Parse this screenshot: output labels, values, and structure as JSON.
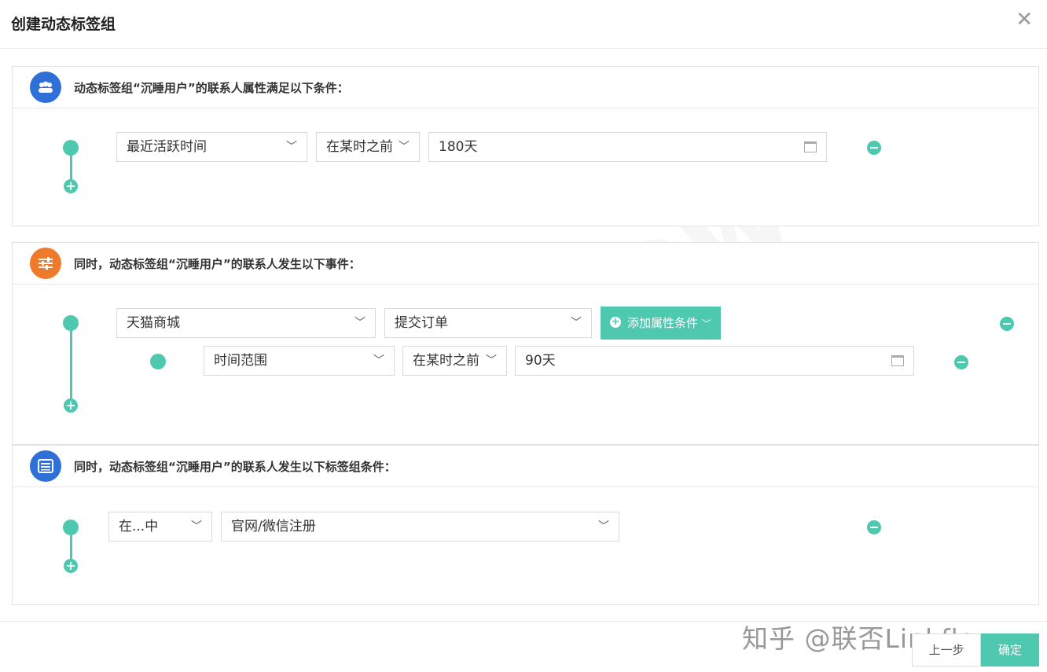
{
  "dialog": {
    "title": "创建动态标签组"
  },
  "watermark": "Linkflow",
  "section1": {
    "title": "动态标签组“沉睡用户”的联系人属性满足以下条件：",
    "icon": "users-icon",
    "icon_color": "#2e6fd8",
    "row": {
      "field": "最近活跃时间",
      "op": "在某时之前",
      "value": "180天"
    }
  },
  "section2": {
    "title": "同时，动态标签组“沉睡用户”的联系人发生以下事件：",
    "icon": "sliders-icon",
    "icon_color": "#f07a2b",
    "row": {
      "source": "天猫商城",
      "event": "提交订单",
      "add_button": "添加属性条件"
    },
    "subrow": {
      "field": "时间范围",
      "op": "在某时之前",
      "value": "90天"
    }
  },
  "section3": {
    "title": "同时，动态标签组“沉睡用户”的联系人发生以下标签组条件：",
    "icon": "list-icon",
    "icon_color": "#2e6fd8",
    "row": {
      "op": "在...中",
      "value": "官网/微信注册"
    }
  },
  "footer": {
    "mark": "知乎 @联否Linkflow",
    "prev": "上一步",
    "ok": "确定"
  },
  "accent_color": "#4ec9b0"
}
